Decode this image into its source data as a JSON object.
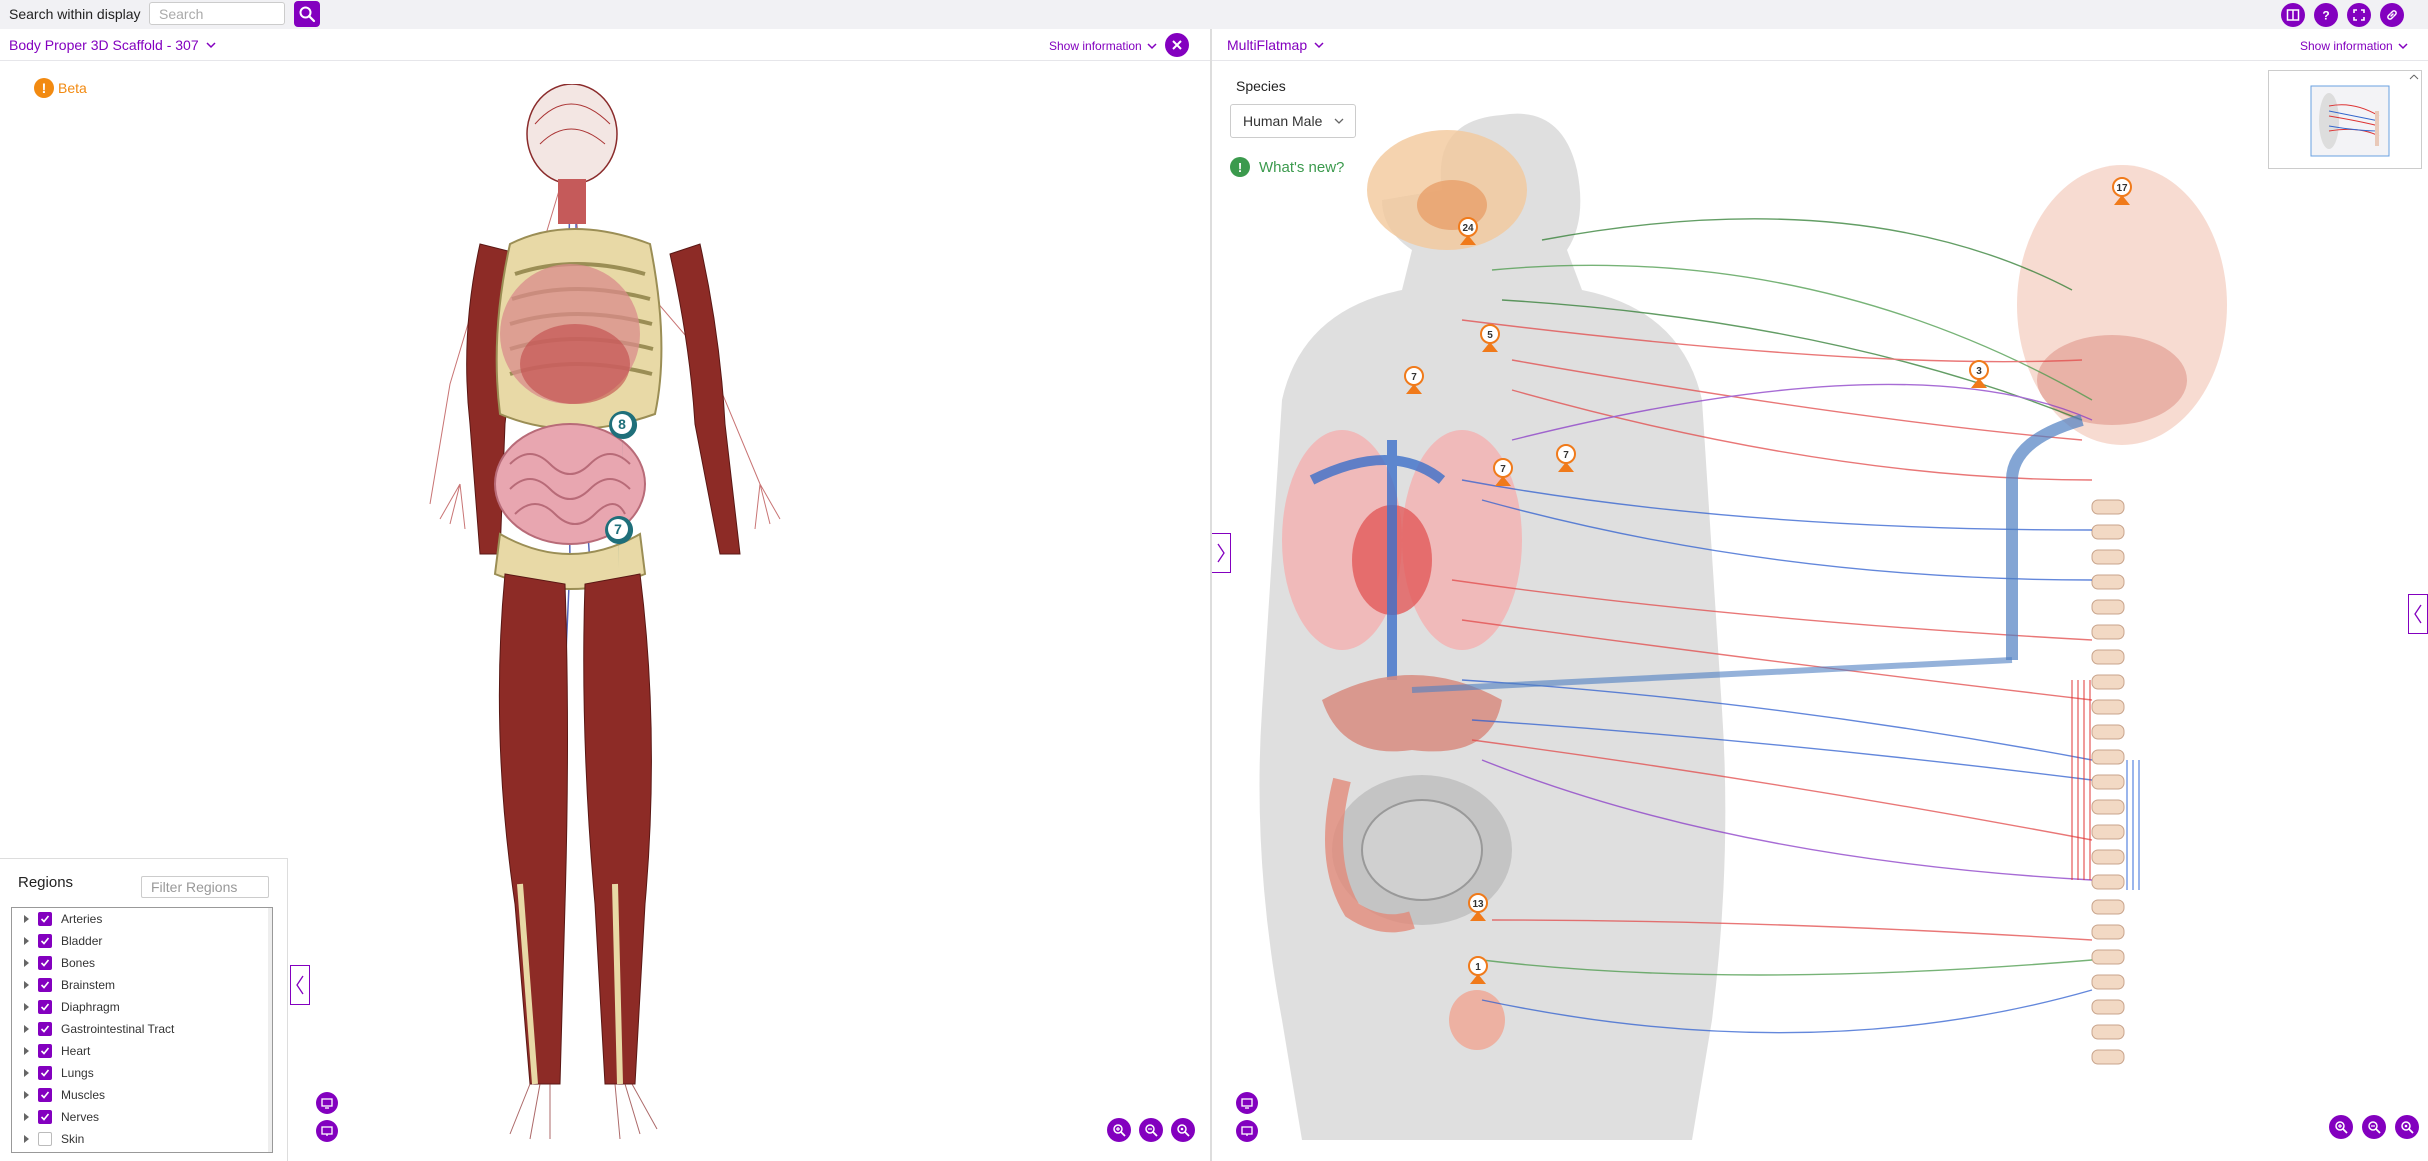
{
  "topbar": {
    "search_label": "Search within display",
    "search_placeholder": "Search",
    "right_icons": [
      "split-view-icon",
      "help-icon",
      "fullscreen-icon",
      "permalink-icon"
    ]
  },
  "left_panel": {
    "title": "Body Proper 3D Scaffold - 307",
    "show_info": "Show information",
    "beta_label": "Beta",
    "markers": [
      "8",
      "7"
    ],
    "regions": {
      "title": "Regions",
      "filter_placeholder": "Filter Regions",
      "items": [
        {
          "label": "Arteries",
          "checked": true
        },
        {
          "label": "Bladder",
          "checked": true
        },
        {
          "label": "Bones",
          "checked": true
        },
        {
          "label": "Brainstem",
          "checked": true
        },
        {
          "label": "Diaphragm",
          "checked": true
        },
        {
          "label": "Gastrointestinal Tract",
          "checked": true
        },
        {
          "label": "Heart",
          "checked": true
        },
        {
          "label": "Lungs",
          "checked": true
        },
        {
          "label": "Muscles",
          "checked": true
        },
        {
          "label": "Nerves",
          "checked": true
        },
        {
          "label": "Skin",
          "checked": false
        }
      ]
    }
  },
  "right_panel": {
    "title": "MultiFlatmap",
    "show_info": "Show information",
    "species_label": "Species",
    "species_value": "Human Male",
    "whats_new": "What's new?",
    "markers": [
      "17",
      "24",
      "5",
      "3",
      "7",
      "7",
      "7",
      "13",
      "1"
    ]
  },
  "colors": {
    "accent": "#8300bf",
    "beta": "#f28a11",
    "whats_new": "#3b9a4d",
    "marker": "#1f6f7a",
    "flat_marker": "#f07a1a"
  }
}
